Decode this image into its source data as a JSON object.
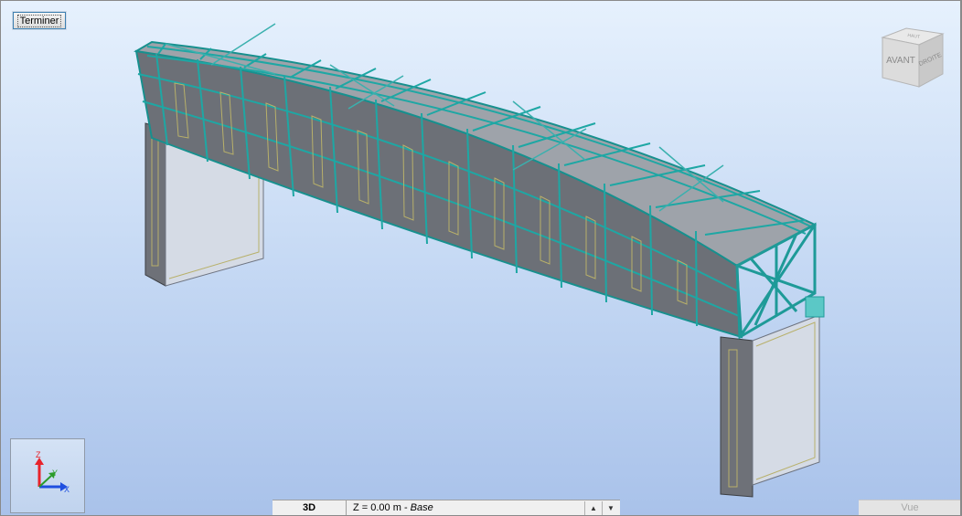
{
  "toolbar": {
    "finish_label": "Terminer"
  },
  "viewcube": {
    "front_label": "AVANT",
    "right_label": "DROITE",
    "top_label": "HAUT"
  },
  "axes": {
    "z_label": "Z",
    "y_label": "Y",
    "x_label": "X",
    "z_color": "#e8232b",
    "y_color": "#2a9c2a",
    "x_color": "#1f4fe0"
  },
  "statusbar": {
    "view_mode": "3D",
    "level_prefix": "Z = 0.00 m - ",
    "level_name": "Base",
    "spin_up_icon": "triangle-up-icon",
    "spin_down_icon": "triangle-down-icon"
  },
  "vue_button": {
    "label": "Vue"
  },
  "colors": {
    "steel": "#1e9a98",
    "deck": "#7b7f86",
    "bracing": "#3ab0ae",
    "pier": "#d2d9e4"
  }
}
